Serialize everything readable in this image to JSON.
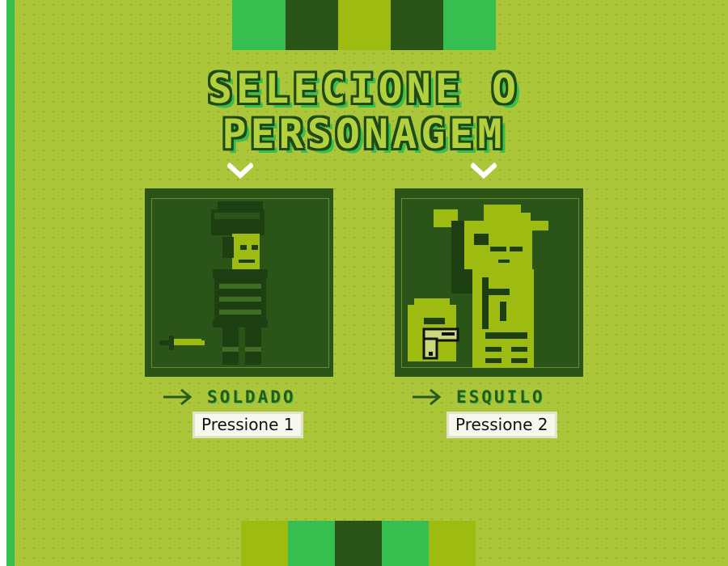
{
  "title": {
    "line1": "SELECIONE O",
    "line2": "PERSONAGEM"
  },
  "palette": [
    "#35bf4f",
    "#2b5518",
    "#9dbb10",
    "#acc63a"
  ],
  "characters": [
    {
      "name": "SOLDADO",
      "prompt": "Pressione 1",
      "weapon": "knife-icon"
    },
    {
      "name": "ESQUILO",
      "prompt": "Pressione 2",
      "weapon": "pistol-icon"
    }
  ]
}
